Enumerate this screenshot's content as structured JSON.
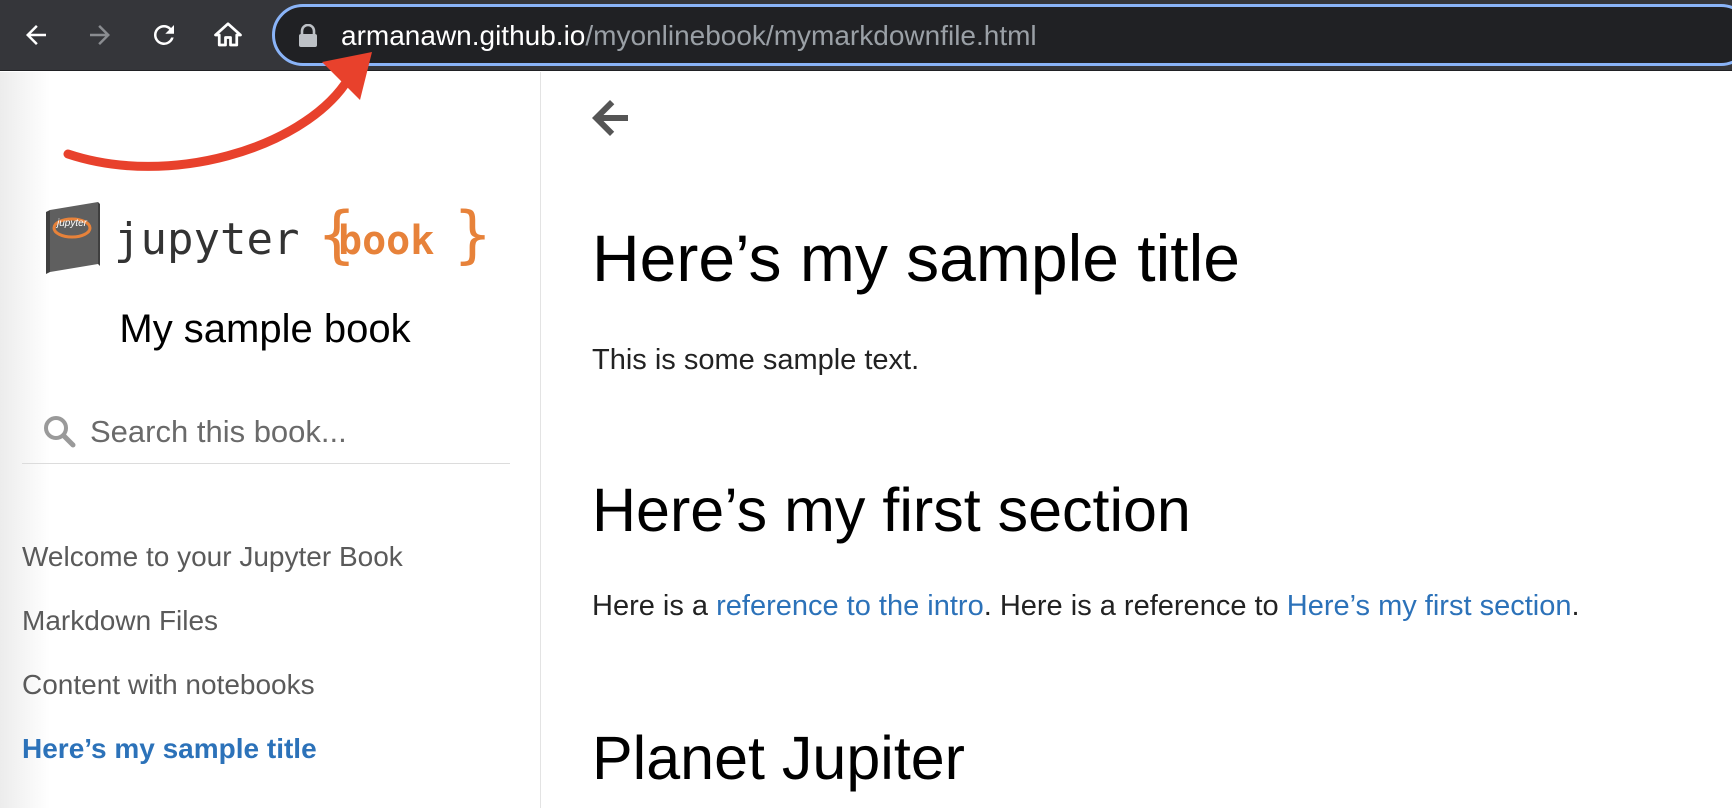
{
  "browser": {
    "url_host": "armanawn.github.io",
    "url_path": "/myonlinebook/mymarkdownfile.html",
    "icons": [
      "back-arrow-icon",
      "forward-arrow-icon",
      "reload-icon",
      "home-icon",
      "lock-icon"
    ]
  },
  "sidebar": {
    "logo": {
      "word1": "jupyter",
      "word2": "book",
      "badge": "jupyter"
    },
    "book_title": "My sample book",
    "search_placeholder": "Search this book...",
    "toc": [
      {
        "label": "Welcome to your Jupyter Book",
        "active": false
      },
      {
        "label": "Markdown Files",
        "active": false
      },
      {
        "label": "Content with notebooks",
        "active": false
      },
      {
        "label": "Here’s my sample title",
        "active": true
      }
    ]
  },
  "content": {
    "title": "Here’s my sample title",
    "intro_text": "This is some sample text.",
    "section1_heading": "Here’s my first section",
    "section1_text": {
      "part1": "Here is a ",
      "link1": "reference to the intro",
      "part2": ". Here is a reference to ",
      "link2": "Here’s my first section",
      "part3": "."
    },
    "section2_heading": "Planet Jupiter"
  },
  "colors": {
    "toolbar_bg": "#35363a",
    "omnibox_bg": "#202124",
    "omnibox_focus_ring": "#8ab4f8",
    "annotation_arrow": "#e8412c",
    "link": "#2c72b9",
    "logo_orange": "#e7823a"
  }
}
